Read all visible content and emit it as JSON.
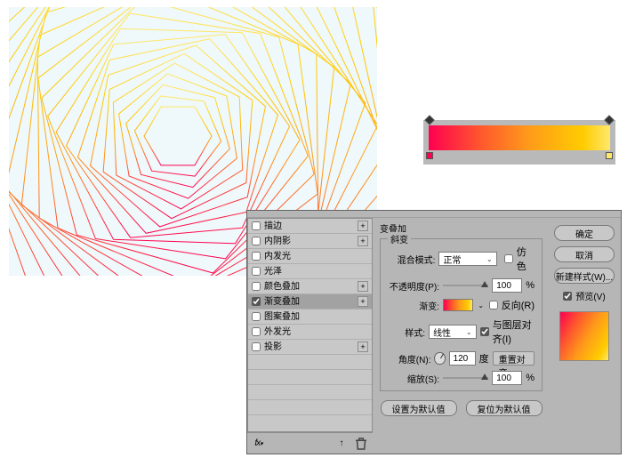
{
  "gradient_editor": {
    "stops": [
      "#ff0050",
      "#ffe86b"
    ]
  },
  "dialog": {
    "section_title": "变叠加",
    "group_title": "斜变",
    "fx_list": [
      {
        "label": "描边",
        "checked": false,
        "has_plus": true
      },
      {
        "label": "内阴影",
        "checked": false,
        "has_plus": true
      },
      {
        "label": "内发光",
        "checked": false,
        "has_plus": false
      },
      {
        "label": "光泽",
        "checked": false,
        "has_plus": false
      },
      {
        "label": "颜色叠加",
        "checked": false,
        "has_plus": true
      },
      {
        "label": "渐变叠加",
        "checked": true,
        "has_plus": true,
        "selected": true
      },
      {
        "label": "图案叠加",
        "checked": false,
        "has_plus": false
      },
      {
        "label": "外发光",
        "checked": false,
        "has_plus": false
      },
      {
        "label": "投影",
        "checked": false,
        "has_plus": true
      }
    ],
    "fields": {
      "blend_label": "混合模式:",
      "blend_value": "正常",
      "dither_label": "仿色",
      "opacity_label": "不透明度(P):",
      "opacity_value": "100",
      "pct": "%",
      "gradient_label": "渐变:",
      "reverse_label": "反向(R)",
      "style_label": "样式:",
      "style_value": "线性",
      "align_label": "与图层对齐(I)",
      "angle_label": "角度(N):",
      "angle_value": "120",
      "degree": "度",
      "reset_align": "重置对齐",
      "scale_label": "缩放(S):",
      "scale_value": "100",
      "make_default": "设置为默认值",
      "reset_default": "复位为默认值"
    },
    "side": {
      "ok": "确定",
      "cancel": "取消",
      "new_style": "新建样式(W)...",
      "preview": "预览(V)"
    }
  }
}
